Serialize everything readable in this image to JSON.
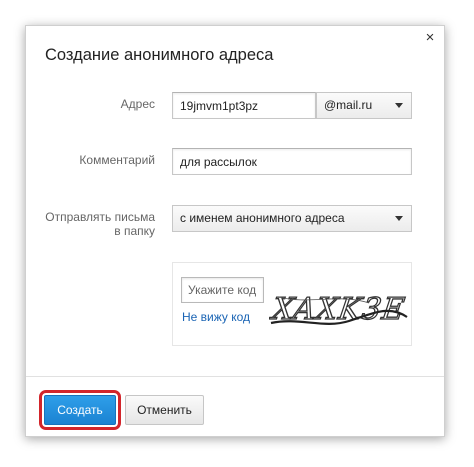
{
  "dialog": {
    "title": "Создание анонимного адреса",
    "close_glyph": "×"
  },
  "form": {
    "address_label": "Адрес",
    "address_value": "19jmvm1pt3pz",
    "domain_value": "@mail.ru",
    "comment_label": "Комментарий",
    "comment_value": "для рассылок",
    "folder_label_line1": "Отправлять письма",
    "folder_label_line2": "в папку",
    "folder_value": "с именем анонимного адреса"
  },
  "captcha": {
    "placeholder": "Укажите код",
    "refresh_link": "Не вижу код",
    "image_text": "XAXK3E"
  },
  "buttons": {
    "create_label": "Создать",
    "cancel_label": "Отменить"
  },
  "colors": {
    "primary": "#1b83d2",
    "link": "#1a64b4",
    "highlight": "#d2252b"
  },
  "icons": {
    "close": "close-icon",
    "dropdown": "chevron-down-icon"
  }
}
